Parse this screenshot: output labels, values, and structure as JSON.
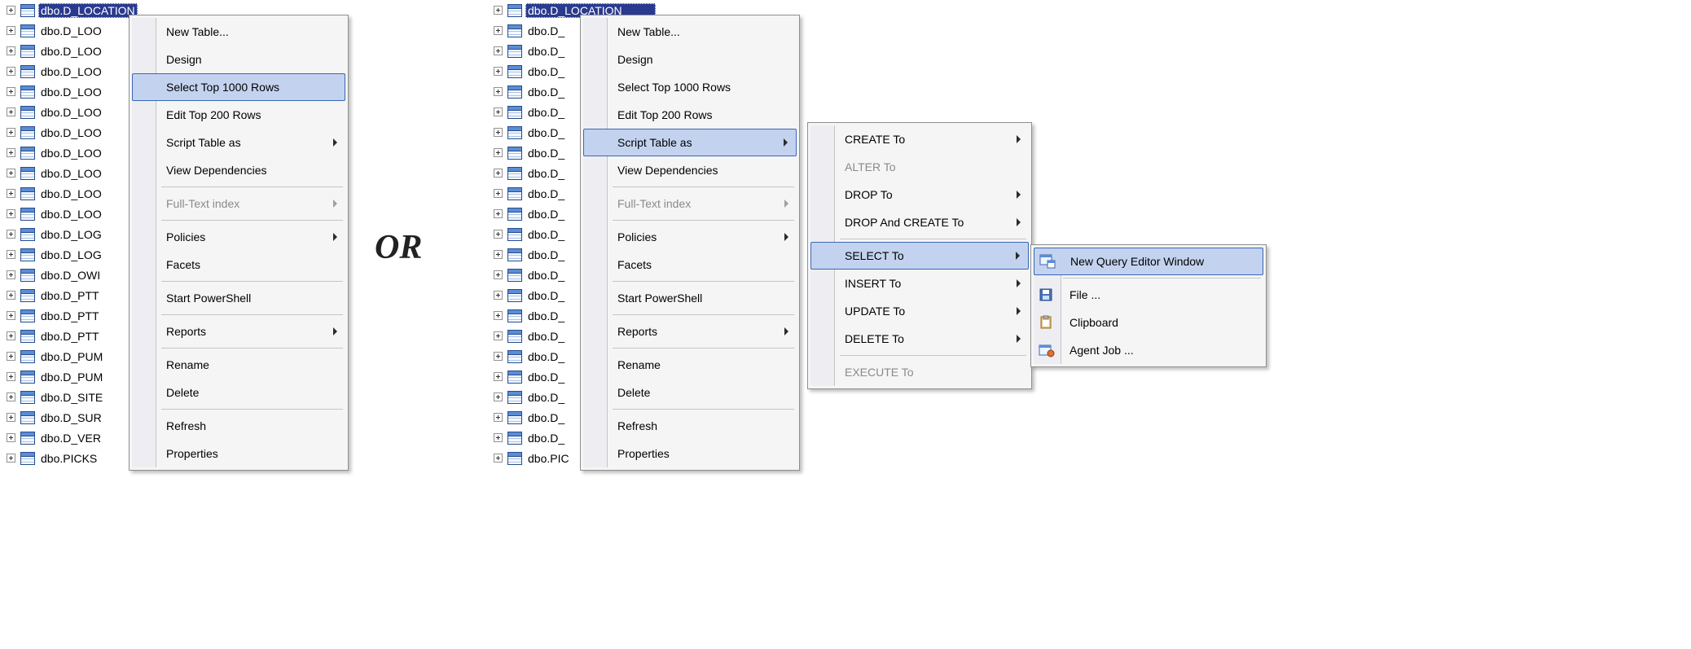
{
  "or_label": "OR",
  "tree_left": {
    "selected_label": "dbo.D_LOCATION",
    "items": [
      "dbo.D_LOO",
      "dbo.D_LOO",
      "dbo.D_LOO",
      "dbo.D_LOO",
      "dbo.D_LOO",
      "dbo.D_LOO",
      "dbo.D_LOO",
      "dbo.D_LOO",
      "dbo.D_LOO",
      "dbo.D_LOO",
      "dbo.D_LOG",
      "dbo.D_LOG",
      "dbo.D_OWI",
      "dbo.D_PTT",
      "dbo.D_PTT",
      "dbo.D_PTT",
      "dbo.D_PUM",
      "dbo.D_PUM",
      "dbo.D_SITE",
      "dbo.D_SUR",
      "dbo.D_VER",
      "dbo.PICKS"
    ]
  },
  "tree_right": {
    "selected_label": "dbo.D_LOCATION",
    "items": [
      "dbo.D_",
      "dbo.D_",
      "dbo.D_",
      "dbo.D_",
      "dbo.D_",
      "dbo.D_",
      "dbo.D_",
      "dbo.D_",
      "dbo.D_",
      "dbo.D_",
      "dbo.D_",
      "dbo.D_",
      "dbo.D_",
      "dbo.D_",
      "dbo.D_",
      "dbo.D_",
      "dbo.D_",
      "dbo.D_",
      "dbo.D_",
      "dbo.D_",
      "dbo.D_",
      "dbo.PIC"
    ]
  },
  "menu1": {
    "new_table": "New Table...",
    "design": "Design",
    "select_top": "Select Top 1000 Rows",
    "edit_top": "Edit Top 200 Rows",
    "script_as": "Script Table as",
    "view_dep": "View Dependencies",
    "fulltext": "Full-Text index",
    "policies": "Policies",
    "facets": "Facets",
    "start_ps": "Start PowerShell",
    "reports": "Reports",
    "rename": "Rename",
    "delete": "Delete",
    "refresh": "Refresh",
    "properties": "Properties"
  },
  "menu2": {
    "create_to": "CREATE To",
    "alter_to": "ALTER To",
    "drop_to": "DROP To",
    "drop_create_to": "DROP And CREATE To",
    "select_to": "SELECT To",
    "insert_to": "INSERT To",
    "update_to": "UPDATE To",
    "delete_to": "DELETE To",
    "execute_to": "EXECUTE To"
  },
  "menu3": {
    "new_query": "New Query Editor Window",
    "file": "File ...",
    "clipboard": "Clipboard",
    "agent_job": "Agent Job ..."
  }
}
